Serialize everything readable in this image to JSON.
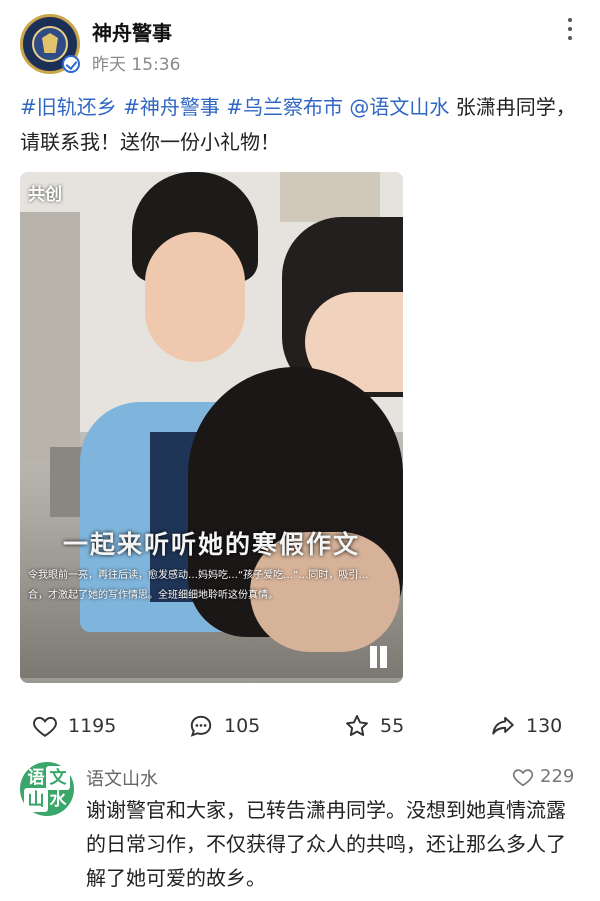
{
  "post": {
    "account_name": "神舟警事",
    "time": "昨天 15:36",
    "tags": [
      "#旧轨还乡",
      "#神舟警事",
      "#乌兰察布市",
      "@语文山水"
    ],
    "text": "张潇冉同学，请联系我！送你一份小礼物！"
  },
  "video": {
    "badge": "共创",
    "caption_title": "一起来听听她的寒假作文",
    "caption_line1": "令我眼前一亮，再往后读，愈发感动…妈妈吃…“孩子爱吃…”…同时，吸引…",
    "caption_line2": "合，才激起了她的写作情思。全班细细地聆听这份真情。"
  },
  "actions": {
    "like_count": "1195",
    "comment_count": "105",
    "favorite_count": "55",
    "share_count": "130"
  },
  "comment": {
    "avatar_glyphs": [
      "语",
      "文",
      "山",
      "水"
    ],
    "author": "语文山水",
    "likes": "229",
    "text": "谢谢警官和大家，已转告潇冉同学。没想到她真情流露的日常习作，不仅获得了众人的共鸣，还让那么多人了解了她可爱的故乡。"
  },
  "colors": {
    "tag_blue": "#3067c4",
    "verify_blue": "#2c69d3",
    "avatar_green": "#3aa66a"
  }
}
